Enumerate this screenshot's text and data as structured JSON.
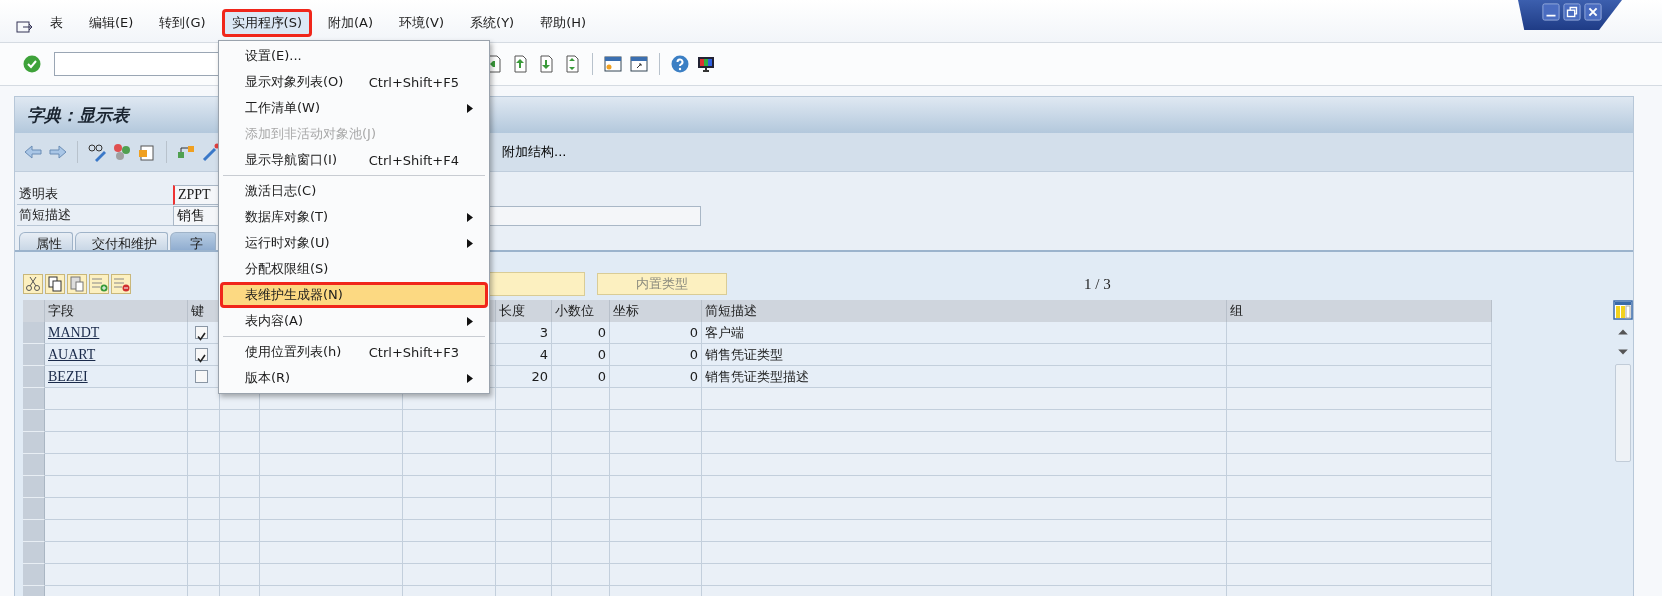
{
  "menubar": {
    "items": [
      {
        "label": "表",
        "selected": false
      },
      {
        "label": "编辑(E)",
        "selected": false
      },
      {
        "label": "转到(G)",
        "selected": false
      },
      {
        "label": "实用程序(S)",
        "selected": true
      },
      {
        "label": "附加(A)",
        "selected": false
      },
      {
        "label": "环境(V)",
        "selected": false
      },
      {
        "label": "系统(Y)",
        "selected": false
      },
      {
        "label": "帮助(H)",
        "selected": false
      }
    ]
  },
  "dropdown": {
    "groups": [
      [
        {
          "label": "设置(E)...",
          "disabled": false,
          "submenu": false,
          "selected": false
        },
        {
          "label": "显示对象列表(O)",
          "shortcut": "Ctrl+Shift+F5",
          "disabled": false,
          "submenu": false,
          "selected": false
        },
        {
          "label": "工作清单(W)",
          "disabled": false,
          "submenu": true,
          "selected": false
        },
        {
          "label": "添加到非活动对象池(J)",
          "disabled": true,
          "submenu": false,
          "selected": false
        },
        {
          "label": "显示导航窗口(I)",
          "shortcut": "Ctrl+Shift+F4",
          "disabled": false,
          "submenu": false,
          "selected": false
        }
      ],
      [
        {
          "label": "激活日志(C)",
          "disabled": false,
          "submenu": false,
          "selected": false
        },
        {
          "label": "数据库对象(T)",
          "disabled": false,
          "submenu": true,
          "selected": false
        },
        {
          "label": "运行时对象(U)",
          "disabled": false,
          "submenu": true,
          "selected": false
        },
        {
          "label": "分配权限组(S)",
          "disabled": false,
          "submenu": false,
          "selected": false
        },
        {
          "label": "表维护生成器(N)",
          "disabled": false,
          "submenu": false,
          "selected": true
        },
        {
          "label": "表内容(A)",
          "disabled": false,
          "submenu": true,
          "selected": false
        }
      ],
      [
        {
          "label": "使用位置列表(h)",
          "shortcut": "Ctrl+Shift+F3",
          "disabled": false,
          "submenu": false,
          "selected": false
        },
        {
          "label": "版本(R)",
          "disabled": false,
          "submenu": true,
          "selected": false
        }
      ]
    ]
  },
  "title": "字典：显示表",
  "app_toolbar": {
    "button": "附加结构..."
  },
  "fields": [
    {
      "label": "透明表",
      "value": "ZPPT"
    },
    {
      "label": "简短描述",
      "value": "销售"
    }
  ],
  "tabs": [
    {
      "label": "属性",
      "selected": false
    },
    {
      "label": "交付和维护",
      "selected": false
    },
    {
      "label": "字",
      "selected": true
    }
  ],
  "table_toolbar": {
    "button": {
      "label": "内置类型",
      "disabled": true
    },
    "page": "1 / 3"
  },
  "table": {
    "columns": [
      "字段",
      "键",
      "长度",
      "小数位",
      "坐标",
      "简短描述",
      "组"
    ],
    "rows": [
      {
        "field": "MANDT",
        "key": true,
        "length": "3",
        "decimals": "0",
        "coordinate": "0",
        "description": "客户端"
      },
      {
        "field": "AUART",
        "key": true,
        "length": "4",
        "decimals": "0",
        "coordinate": "0",
        "description": "销售凭证类型"
      },
      {
        "field": "BEZEI",
        "key": false,
        "length": "20",
        "decimals": "0",
        "coordinate": "0",
        "description": "销售凭证类型描述"
      }
    ]
  }
}
